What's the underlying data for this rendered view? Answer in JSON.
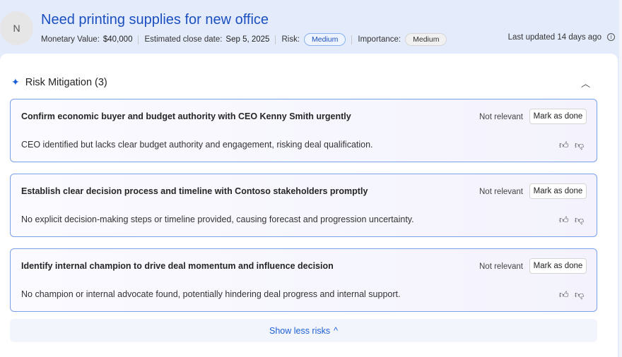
{
  "header": {
    "avatar_initial": "N",
    "title": "Need printing supplies for new office",
    "monetary_label": "Monetary Value:",
    "monetary_value": "$40,000",
    "close_label": "Estimated close date:",
    "close_value": "Sep 5, 2025",
    "risk_label": "Risk:",
    "risk_value": "Medium",
    "importance_label": "Importance:",
    "importance_value": "Medium",
    "last_updated": "Last updated 14 days ago"
  },
  "section": {
    "title": "Risk Mitigation (3)",
    "show_less": "Show less risks"
  },
  "risks": [
    {
      "title": "Confirm economic buyer and budget authority with CEO Kenny Smith urgently",
      "description": "CEO identified but lacks clear budget authority and engagement, risking deal qualification.",
      "not_relevant": "Not relevant",
      "mark_done": "Mark as done"
    },
    {
      "title": "Establish clear decision process and timeline with Contoso stakeholders promptly",
      "description": "No explicit decision-making steps or timeline provided, causing forecast and progression uncertainty.",
      "not_relevant": "Not relevant",
      "mark_done": "Mark as done"
    },
    {
      "title": "Identify internal champion to drive deal momentum and influence decision",
      "description": "No champion or internal advocate found, potentially hindering deal progress and internal support.",
      "not_relevant": "Not relevant",
      "mark_done": "Mark as done"
    }
  ],
  "colors": {
    "accent": "#1b4fbf",
    "card_border": "#7aa0ea",
    "header_bg": "#e4ecfb"
  }
}
